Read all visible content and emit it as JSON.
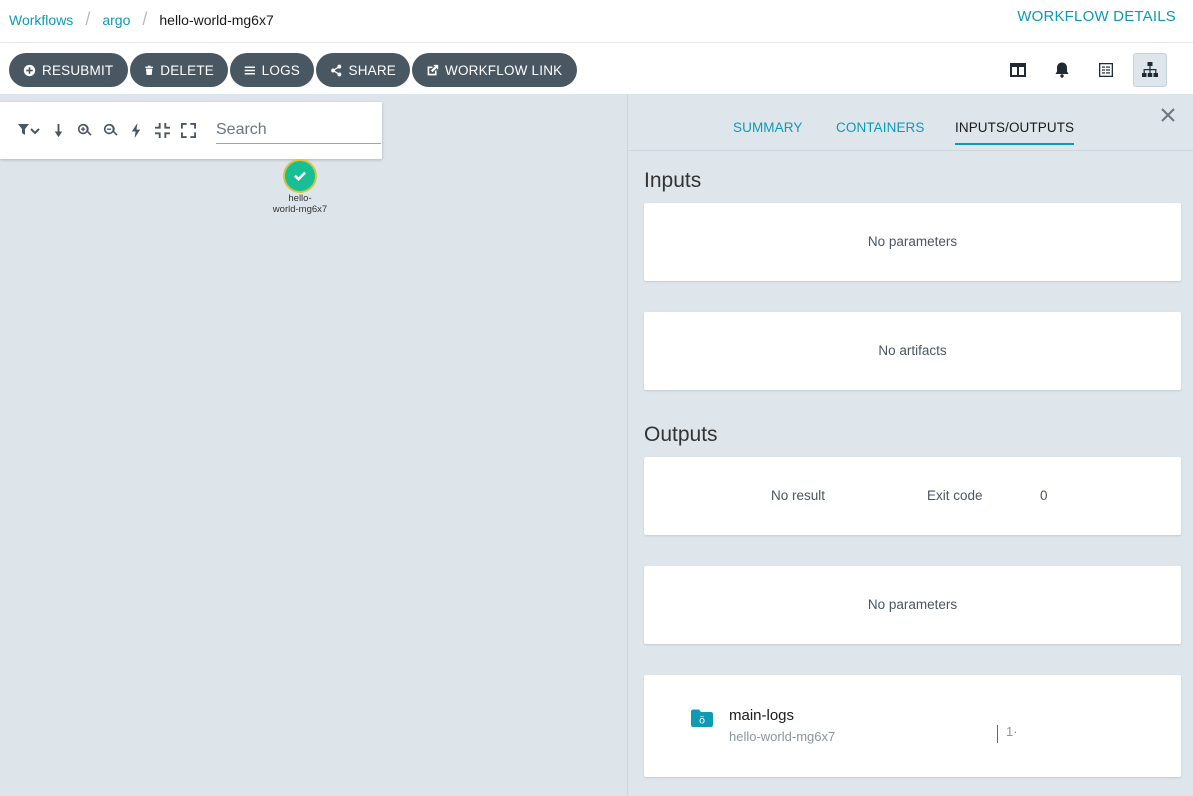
{
  "breadcrumb": {
    "items": [
      "Workflows",
      "argo",
      "hello-world-mg6x7"
    ]
  },
  "page_title": "WORKFLOW DETAILS",
  "toolbar": {
    "resubmit": "RESUBMIT",
    "delete": "DELETE",
    "logs": "LOGS",
    "share": "SHARE",
    "workflow_link": "WORKFLOW LINK"
  },
  "view_switcher": {
    "icons": [
      "split-view-icon",
      "bell-icon",
      "list-view-icon",
      "tree-graph-icon"
    ],
    "active": "tree-graph-icon"
  },
  "graph": {
    "search_placeholder": "Search",
    "node": {
      "label_line1": "hello-",
      "label_line2": "world-mg6x7",
      "status": "succeeded"
    }
  },
  "panel": {
    "tabs": [
      "SUMMARY",
      "CONTAINERS",
      "INPUTS/OUTPUTS"
    ],
    "active_tab": "INPUTS/OUTPUTS",
    "inputs": {
      "title": "Inputs",
      "parameters_text": "No parameters",
      "artifacts_text": "No artifacts"
    },
    "outputs": {
      "title": "Outputs",
      "result_label": "No result",
      "exit_code_label": "Exit code",
      "exit_code_value": "0",
      "parameters_text": "No parameters",
      "artifact": {
        "name": "main-logs",
        "workflow": "hello-world-mg6x7",
        "truncated": "1·"
      }
    }
  },
  "colors": {
    "accent": "#0d9ab3",
    "button_bg": "#495763",
    "success": "#18be94",
    "panel_bg": "#dee6eb",
    "canvas_bg": "#dde4ea"
  }
}
